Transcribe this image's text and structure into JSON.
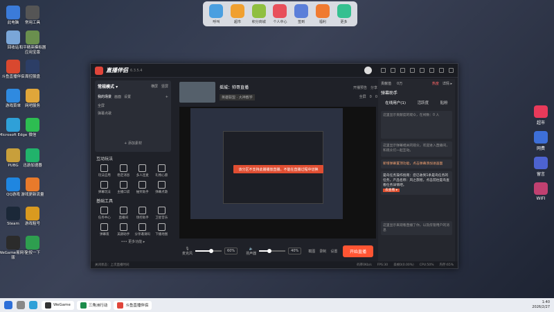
{
  "desktop_icons": [
    {
      "label": "此电脑",
      "color": "#3b7bd9"
    },
    {
      "label": "常用工具",
      "color": "#555"
    },
    {
      "label": "回收站",
      "color": "#7aa6d8"
    },
    {
      "label": "和平精英模拟器应用宝版",
      "color": "#6a8f4e"
    },
    {
      "label": "斗鱼直播伴侣",
      "color": "#d9482f"
    },
    {
      "label": "周控服盘",
      "color": "#2c3e66"
    },
    {
      "label": "游戏菜单",
      "color": "#2f8ae0"
    },
    {
      "label": "网吧服务",
      "color": "#e0a63a"
    },
    {
      "label": "Microsoft Edge",
      "color": "#2fa0d8"
    },
    {
      "label": "微信",
      "color": "#2dbd51"
    },
    {
      "label": "PUBG",
      "color": "#c89f3b"
    },
    {
      "label": "迅游加速器",
      "color": "#21b36b"
    },
    {
      "label": "QQ游戏",
      "color": "#1f86e0"
    },
    {
      "label": "游戏更新流量",
      "color": "#e87a2b"
    },
    {
      "label": "Steam",
      "color": "#1b2838"
    },
    {
      "label": "游戏租号",
      "color": "#d99a20"
    },
    {
      "label": "WeGame易网专版",
      "color": "#2b2b2b"
    },
    {
      "label": "全按一下",
      "color": "#2e9e4f"
    }
  ],
  "dock": [
    {
      "label": "呼叫",
      "color": "#4a9fe0"
    },
    {
      "label": "超市",
      "color": "#f0a030"
    },
    {
      "label": "积分商城",
      "color": "#8fbf40"
    },
    {
      "label": "个人中心",
      "color": "#e8505b"
    },
    {
      "label": "签到",
      "color": "#5b7fd9"
    },
    {
      "label": "福利",
      "color": "#f07a30"
    },
    {
      "label": "更多",
      "color": "#35c090"
    }
  ],
  "right_dock": [
    {
      "label": "超市",
      "color": "#e83a5a"
    },
    {
      "label": "网费",
      "color": "#3d6fd8"
    },
    {
      "label": "留言",
      "color": "#4d63d0"
    },
    {
      "label": "WIFI",
      "color": "#c04070"
    }
  ],
  "app": {
    "title": "直播伴侣",
    "version": "6.3.5.4",
    "scene": {
      "mode": "常规模式 ▾",
      "tab_a": "横屏",
      "tab_b": "竖屏",
      "list_title": "我的场景",
      "tab_c": "画面",
      "tab_d": "设置",
      "items": [
        "全屏",
        "弹幕点歌"
      ],
      "add": "+ 添加素材"
    },
    "interactive": {
      "title": "互动玩法",
      "items": [
        "玩法应用",
        "稳定消息",
        "多人连麦",
        "礼物心愿",
        "弹幕玩法",
        "主播口袋",
        "抽奖助手",
        "弹幕点歌"
      ]
    },
    "basic": {
      "title": "基础工具",
      "items": [
        "任务中心",
        "直播间",
        "场控助手",
        "卫星音乐",
        "弹幕夜",
        "美颜助手",
        "分享邀请码",
        "下播地图"
      ],
      "more": "••• 更多功能 ▸"
    },
    "stream": {
      "title": "摇城：帅哥直播",
      "category": "英雄联盟 · 大神教学",
      "open_preview": "开播预告",
      "share": "分享",
      "full_screen": "全屏",
      "likes": "0",
      "fans": "0"
    },
    "notice": "该分区不支持此播播放直播，不能在直播过程中切换",
    "controls": {
      "mic_label": "麦克风",
      "mic_pct": "60%",
      "speaker_label": "扬声器",
      "speaker_pct": "40%",
      "mic_level": 0.6,
      "speaker_level": 0.4,
      "btn_a": "截图",
      "btn_b": "录制",
      "btn_c": "设置",
      "start": "开始直播"
    },
    "status": [
      "关闭状态：上次直播时间",
      "码率0Kb/s",
      "FPS:30",
      "丢帧0(0.00%)",
      "CPU:50%",
      "内存:65%"
    ],
    "right_panel": {
      "header_left": "贡献值",
      "header_mid": "0万",
      "tab_live": "热度",
      "tab_detail": "详情 ▸",
      "section": "弹幕助手",
      "tabs": [
        "在线用户(1)",
        "活跃度",
        "贴粉"
      ],
      "block1": "这里显示贡献度的观众，在线数：0 人",
      "block2": "这里显示弹幕相关的观众，欢迎进入直播间，和观众们一起互动。",
      "tip_title": "新增弹幕置顶功能，点击弹幕添加进画面",
      "tip_body": "是鸟任务操作指南：您已收到1条是鸟任务的任务，产品名称：风之旅程，点击前往是鸟查看任务详情吧。",
      "tip_link": "去查看 ▸",
      "bottom": "这里显示来观看直播了你，以及房管用户的消息"
    }
  },
  "taskbar": {
    "apps": [
      "WeGame",
      "三角洲行动",
      "斗鱼直播伴侣"
    ],
    "time": "1:40",
    "date": "2026/2/27"
  }
}
